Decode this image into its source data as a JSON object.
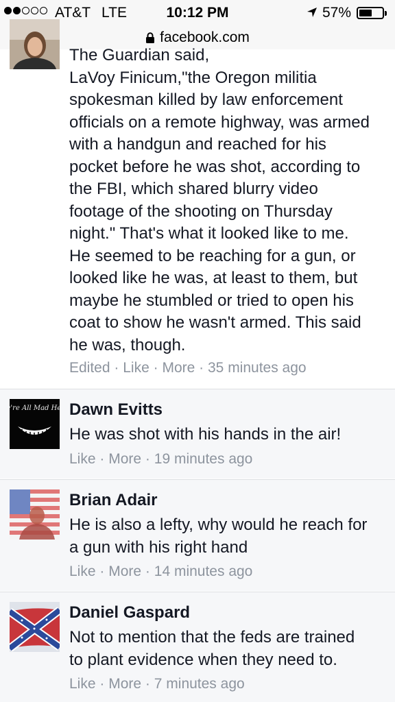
{
  "status_bar": {
    "carrier": "AT&T",
    "network": "LTE",
    "time": "10:12 PM",
    "battery": "57%",
    "battery_level": 0.57,
    "signal_bars": 2,
    "signal_total": 5
  },
  "url_bar": {
    "domain": "facebook.com"
  },
  "comments": [
    {
      "author": "",
      "lines": [
        "The Guardian said,",
        "LaVoy Finicum,\"the Oregon militia",
        "spokesman killed by law enforcement",
        "officials on a remote highway, was armed",
        "with a handgun and reached for his",
        "pocket before he was shot, according to",
        "the FBI, which shared blurry video",
        "footage of the shooting on Thursday",
        "night.\" That's what it looked like to me.",
        "He seemed to be reaching for a gun, or",
        "looked like he was, at least to them, but",
        "maybe he stumbled or tried to open his",
        "coat to show he wasn't armed. This said",
        "he was, though."
      ],
      "meta": {
        "edited": "Edited",
        "like": "Like",
        "more": "More",
        "sep": "·",
        "time": "35 minutes ago"
      }
    },
    {
      "author": "Dawn Evitts",
      "avatar_text": "We're All Mad Here",
      "lines": [
        "He was shot with his hands in the air!"
      ],
      "meta": {
        "like": "Like",
        "more": "More",
        "sep": "·",
        "time": "19 minutes ago"
      }
    },
    {
      "author": "Brian Adair",
      "lines": [
        "He is also a lefty, why would he reach for",
        "a gun with his right hand"
      ],
      "meta": {
        "like": "Like",
        "more": "More",
        "sep": "·",
        "time": "14 minutes ago"
      }
    },
    {
      "author": "Daniel Gaspard",
      "lines": [
        "Not to mention that the feds are trained",
        "to plant evidence when they need to."
      ],
      "meta": {
        "like": "Like",
        "more": "More",
        "sep": "·",
        "time": "7 minutes ago"
      }
    }
  ],
  "colors": {
    "meta_text": "#8d949e",
    "body_text": "#141823",
    "reply_background": "#f6f7f9"
  }
}
